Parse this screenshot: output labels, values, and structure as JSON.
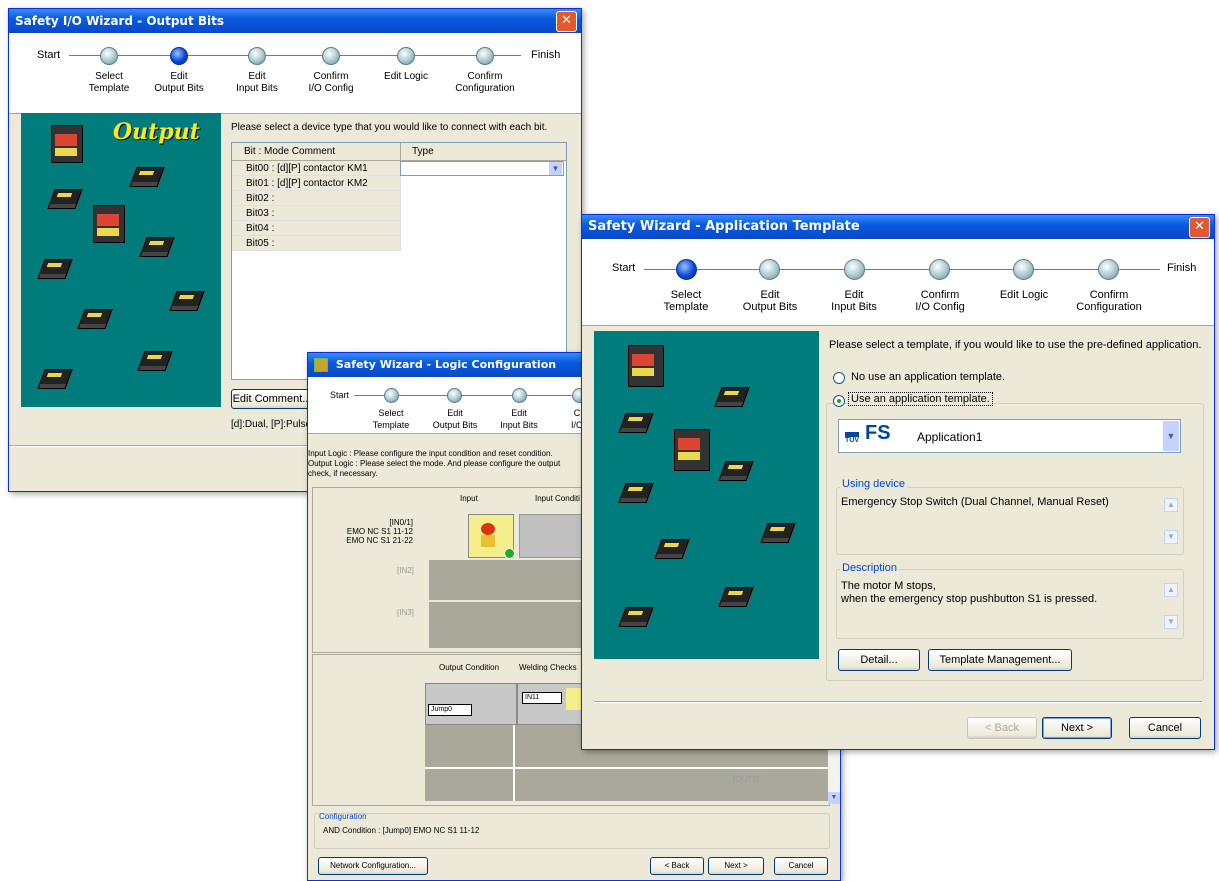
{
  "output_bits_window": {
    "title": "Safety I/O Wizard - Output Bits",
    "steps": {
      "start": "Start",
      "finish": "Finish",
      "items": [
        "Select\nTemplate",
        "Edit\nOutput Bits",
        "Edit\nInput Bits",
        "Confirm\nI/O Config",
        "Edit Logic",
        "Confirm\nConfiguration"
      ]
    },
    "banner": "Output",
    "instruction": "Please select a device type that you would like to connect with each bit.",
    "table": {
      "col_bit": "Bit : Mode Comment",
      "col_type": "Type",
      "rows": [
        "Bit00 : [d][P] contactor KM1",
        "Bit01 : [d][P] contactor KM2",
        "Bit02 :",
        "Bit03 :",
        "Bit04 :",
        "Bit05 :"
      ]
    },
    "edit_comment_button": "Edit Comment...",
    "legend": "[d]:Dual, [P]:Pulse"
  },
  "logic_window": {
    "title": "Safety Wizard - Logic Configuration",
    "steps": {
      "start": "Start",
      "items": [
        "Select\nTemplate",
        "Edit\nOutput Bits",
        "Edit\nInput Bits",
        "C\nI/O"
      ]
    },
    "desc_line1": "Input Logic : Please configure the input condition and reset condition.",
    "desc_line2": "Output Logic : Please select the mode. And please configure the output",
    "desc_line3": "check, if necessary.",
    "col_input": "Input",
    "col_input_cond": "Input Conditi",
    "in0": "[IN0/1]",
    "in0_a": "EMO NC S1 11-12",
    "in0_b": "EMO NC S1 21-22",
    "in2": "[IN2]",
    "in3": "[IN3]",
    "col_output_cond": "Output Condition",
    "col_welding": "Welding Checks",
    "jump0": "Jump0",
    "in11": "IN11",
    "out3": "[OUT3]",
    "config_title": "Configuration",
    "config_text": "AND Condition : [Jump0] EMO NC S1 11-12",
    "network_button": "Network Configuration...",
    "back_button": "< Back",
    "next_button": "Next >",
    "cancel_button": "Cancel"
  },
  "template_window": {
    "title": "Safety Wizard - Application Template",
    "steps": {
      "start": "Start",
      "finish": "Finish",
      "items": [
        "Select\nTemplate",
        "Edit\nOutput Bits",
        "Edit\nInput Bits",
        "Confirm\nI/O Config",
        "Edit Logic",
        "Confirm\nConfiguration"
      ]
    },
    "instruction": "Please select a template, if you would like to use the pre-defined application.",
    "radio_no": "No use an application template.",
    "radio_use": "Use an application template.",
    "selected_template": "Application1",
    "logo_tuv": "TÜV",
    "logo_fs": "FS",
    "using_device_title": "Using device",
    "using_device_text": "Emergency Stop Switch (Dual Channel, Manual Reset)",
    "description_title": "Description",
    "description_line1": "The motor M stops,",
    "description_line2": "when the emergency stop pushbutton S1 is pressed.",
    "detail_button": "Detail...",
    "template_mgmt_button": "Template Management...",
    "back_button": "< Back",
    "next_button": "Next >",
    "cancel_button": "Cancel"
  }
}
